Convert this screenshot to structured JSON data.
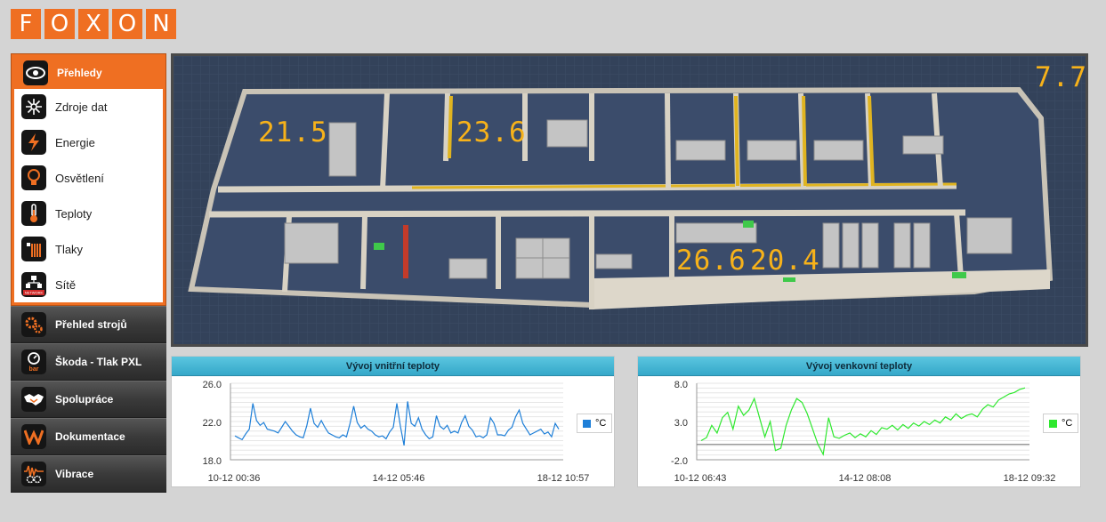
{
  "logo": {
    "letters": [
      "F",
      "O",
      "X",
      "O",
      "N"
    ]
  },
  "sidebar": {
    "active_group": {
      "label": "Přehledy",
      "icon": "eye-icon"
    },
    "sub_items": [
      {
        "label": "Zdroje dat",
        "icon": "data-source-icon"
      },
      {
        "label": "Energie",
        "icon": "lightning-icon"
      },
      {
        "label": "Osvětlení",
        "icon": "bulb-icon"
      },
      {
        "label": "Teploty",
        "icon": "thermometer-icon"
      },
      {
        "label": "Tlaky",
        "icon": "pressure-icon"
      },
      {
        "label": "Sítě",
        "icon": "network-icon"
      }
    ],
    "groups": [
      {
        "label": "Přehled strojů",
        "icon": "gears-icon"
      },
      {
        "label": "Škoda - Tlak PXL",
        "icon": "pressure-gauge-icon"
      },
      {
        "label": "Spolupráce",
        "icon": "handshake-icon"
      },
      {
        "label": "Dokumentace",
        "icon": "document-icon"
      },
      {
        "label": "Vibrace",
        "icon": "vibration-icon"
      }
    ],
    "icon_small_texts": {
      "network": "NETWORK",
      "bar": "bar"
    }
  },
  "floorplan": {
    "outdoor_temp": "7.7",
    "room_temps": [
      "21.5",
      "23.6",
      "26.6",
      "20.4"
    ]
  },
  "colors": {
    "accent": "#ef6f22",
    "temp_digits": "#f7b21a",
    "chart_inner": "#1e7fd8",
    "chart_outer": "#2ee82e",
    "chart_header": "#35a8c9"
  },
  "charts": {
    "inner": {
      "title": "Vývoj vnitřní teploty",
      "legend": "°C",
      "yticks": [
        "26.0",
        "22.0",
        "18.0"
      ],
      "xticks": [
        "10-12 00:36",
        "14-12 05:46",
        "18-12 10:57"
      ]
    },
    "outer": {
      "title": "Vývoj venkovní teploty",
      "legend": "°C",
      "yticks": [
        "8.0",
        "3.0",
        "-2.0"
      ],
      "xticks": [
        "10-12 06:43",
        "14-12 08:08",
        "18-12 09:32"
      ]
    }
  },
  "chart_data": [
    {
      "type": "line",
      "title": "Vývoj vnitřní teploty",
      "ylim": [
        18,
        26
      ],
      "x_range": [
        "10-12 00:36",
        "18-12 10:57"
      ],
      "series": [
        {
          "name": "°C",
          "color": "#1e7fd8",
          "values": [
            20.5,
            20.3,
            20.1,
            20.7,
            21.2,
            23.9,
            22.1,
            21.6,
            21.9,
            21.2,
            21.1,
            21.0,
            20.8,
            21.4,
            22.0,
            21.5,
            21.0,
            20.6,
            20.4,
            20.3,
            21.6,
            23.4,
            21.8,
            21.4,
            22.1,
            21.4,
            20.8,
            20.6,
            20.4,
            20.3,
            20.6,
            20.4,
            21.8,
            23.6,
            21.9,
            21.3,
            21.6,
            21.2,
            21.0,
            20.6,
            20.4,
            20.5,
            20.2,
            20.9,
            21.4,
            23.9,
            21.5,
            19.5,
            24.1,
            21.8,
            21.5,
            22.4,
            21.2,
            20.6,
            20.2,
            20.4,
            22.6,
            21.5,
            21.2,
            21.6,
            20.8,
            21.0,
            20.8,
            21.9,
            22.6,
            21.5,
            21.1,
            20.4,
            20.5,
            20.3,
            20.6,
            22.4,
            21.8,
            20.6,
            20.6,
            20.5,
            21.1,
            21.4,
            22.5,
            23.2,
            21.8,
            21.2,
            20.6,
            20.8,
            21.0,
            21.2,
            20.7,
            20.9,
            20.4,
            21.8,
            21.2
          ]
        }
      ]
    },
    {
      "type": "line",
      "title": "Vývoj venkovní teploty",
      "ylim": [
        -2,
        8
      ],
      "x_range": [
        "10-12 06:43",
        "18-12 09:32"
      ],
      "series": [
        {
          "name": "°C",
          "color": "#2ee82e",
          "values": [
            0.5,
            0.9,
            2.5,
            1.5,
            3.5,
            4.2,
            2.0,
            5.0,
            3.8,
            4.5,
            6.0,
            3.5,
            1.0,
            3.0,
            -0.8,
            -0.5,
            2.5,
            4.5,
            6.0,
            5.5,
            4.0,
            2.0,
            0.0,
            -1.3,
            3.5,
            1.0,
            0.8,
            1.2,
            1.5,
            0.9,
            1.4,
            1.0,
            1.8,
            1.3,
            2.2,
            2.0,
            2.5,
            1.9,
            2.6,
            2.1,
            2.8,
            2.4,
            3.0,
            2.6,
            3.2,
            2.8,
            3.6,
            3.2,
            4.0,
            3.4,
            3.8,
            4.0,
            3.6,
            4.6,
            5.2,
            4.9,
            5.8,
            6.2,
            6.6,
            6.8,
            7.2,
            7.4
          ]
        }
      ]
    }
  ]
}
